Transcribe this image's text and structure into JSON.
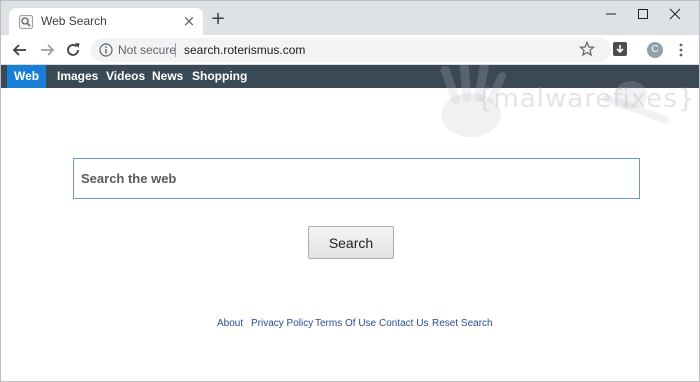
{
  "browser": {
    "tab": {
      "title": "Web Search",
      "close_glyph": "×",
      "favicon": "search-icon"
    },
    "new_tab_glyph": "+",
    "window_controls": [
      "minimize-icon",
      "maximize-icon",
      "close-icon"
    ],
    "address_bar": {
      "security_label": "Not secure",
      "url": "search.roterismus.com"
    },
    "profile_initial": "C"
  },
  "site_nav": {
    "items": [
      {
        "label": "Web",
        "active": true
      },
      {
        "label": "Images",
        "active": false
      },
      {
        "label": "Videos",
        "active": false
      },
      {
        "label": "News",
        "active": false
      },
      {
        "label": "Shopping",
        "active": false
      }
    ]
  },
  "watermark": {
    "text": "{malwarefixes}"
  },
  "search": {
    "placeholder": "Search the web",
    "button_label": "Search"
  },
  "footer": {
    "links": [
      "About",
      "Privacy Policy",
      "Terms Of Use",
      "Contact Us",
      "Reset Search"
    ]
  },
  "colors": {
    "nav_bar": "#3b4955",
    "nav_active": "#1a7fd4",
    "search_border": "#6b9ad6",
    "footer_link": "#2a4d8f"
  }
}
